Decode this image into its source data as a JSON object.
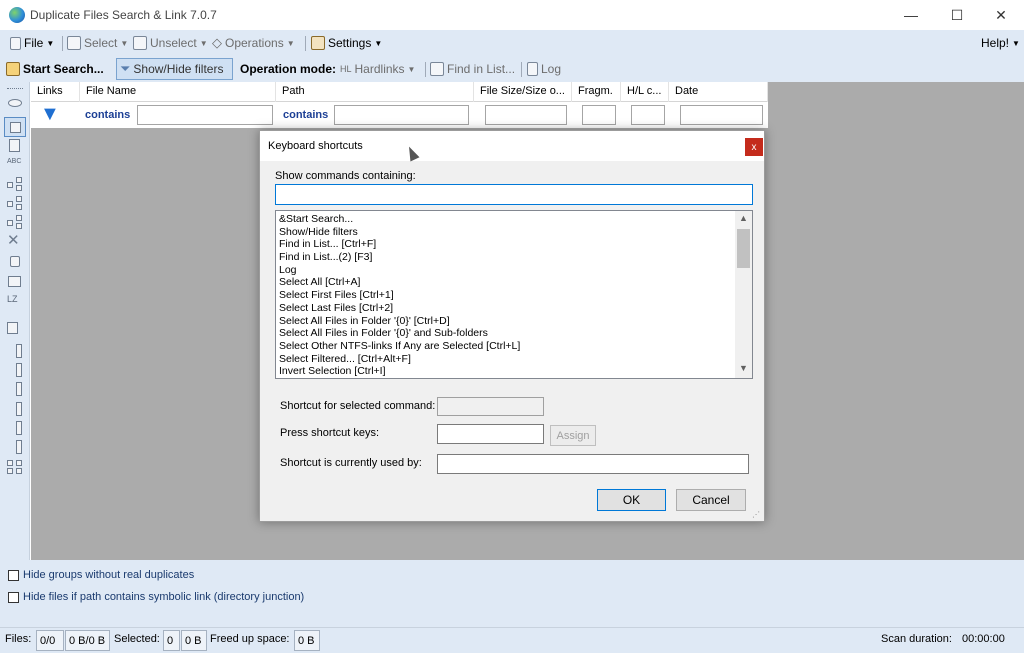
{
  "window": {
    "title": "Duplicate Files Search & Link 7.0.7",
    "minimize": "—",
    "maximize": "☐",
    "close": "✕"
  },
  "menu": {
    "file": "File",
    "select": "Select",
    "unselect": "Unselect",
    "operations": "Operations",
    "settings": "Settings",
    "help": "Help!"
  },
  "toolbar": {
    "start_search": "Start Search...",
    "show_hide_filters": "Show/Hide filters",
    "operation_mode_label": "Operation mode:",
    "hardlinks": "Hardlinks",
    "find_in_list": "Find in List...",
    "log": "Log"
  },
  "grid": {
    "columns": [
      "Links",
      "File Name",
      "Path",
      "File Size/Size o...",
      "Fragm.",
      "H/L c...",
      "Date"
    ],
    "filter_contains": "contains"
  },
  "dialog": {
    "title": "Keyboard shortcuts",
    "close": "x",
    "search_label": "Show commands containing:",
    "search_value": "",
    "commands": [
      "&Start Search...",
      "Show/Hide filters",
      "Find in List... [Ctrl+F]",
      "Find in List...(2) [F3]",
      "Log",
      "Select All [Ctrl+A]",
      "Select First Files [Ctrl+1]",
      "Select Last Files [Ctrl+2]",
      "Select All Files in Folder '{0}' [Ctrl+D]",
      "Select All Files in Folder '{0}' and Sub-folders",
      "Select Other NTFS-links If Any are Selected [Ctrl+L]",
      "Select Filtered... [Ctrl+Alt+F]",
      "Invert Selection [Ctrl+I]"
    ],
    "shortcut_selected_label": "Shortcut for selected command:",
    "press_keys_label": "Press shortcut keys:",
    "assign": "Assign",
    "used_by_label": "Shortcut is currently used by:",
    "ok": "OK",
    "cancel": "Cancel"
  },
  "options": {
    "hide_groups": "Hide groups without real duplicates",
    "hide_symlink": "Hide files if path contains symbolic link (directory junction)"
  },
  "status": {
    "files_label": "Files:",
    "files_count": "0/0",
    "files_size": "0 B/0 B",
    "selected_label": "Selected:",
    "selected_count": "0",
    "selected_size": "0 B",
    "freed_label": "Freed up space:",
    "freed_value": "0 B",
    "scan_label": "Scan duration:",
    "scan_value": "00:00:00"
  },
  "left_toolbar": {
    "lz_label": "LZ",
    "abc_label": "ABC"
  }
}
